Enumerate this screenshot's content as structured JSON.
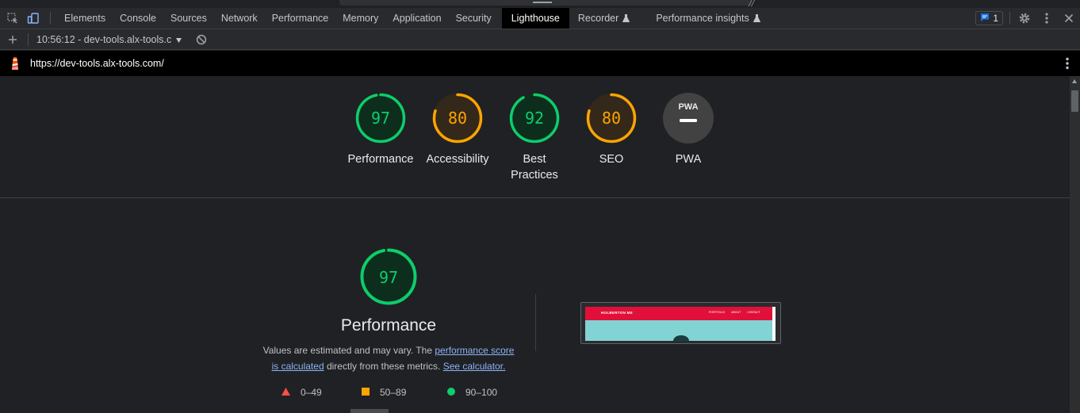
{
  "toolbar": {
    "tabs": [
      {
        "label": "Elements"
      },
      {
        "label": "Console"
      },
      {
        "label": "Sources"
      },
      {
        "label": "Network"
      },
      {
        "label": "Performance"
      },
      {
        "label": "Memory"
      },
      {
        "label": "Application"
      },
      {
        "label": "Security"
      },
      {
        "label": "Lighthouse",
        "active": true
      },
      {
        "label": "Recorder",
        "experimental": true
      },
      {
        "label": "Performance insights",
        "experimental": true
      }
    ],
    "issues_count": "1",
    "icons": [
      "inspect-element-icon",
      "device-toolbar-icon",
      "issues-chat-icon",
      "settings-gear-icon",
      "more-vertical-icon",
      "close-icon"
    ]
  },
  "report_bar": {
    "report_label": "10:56:12 - dev-tools.alx-tools.c",
    "icons": [
      "add-icon",
      "dropdown-triangle-icon",
      "clear-block-icon"
    ]
  },
  "url_bar": {
    "url": "https://dev-tools.alx-tools.com/",
    "icons": [
      "lighthouse-icon",
      "more-vertical-icon"
    ]
  },
  "gauges": [
    {
      "score": "97",
      "value": 97,
      "label": "Performance",
      "status": "pass"
    },
    {
      "score": "80",
      "value": 80,
      "label": "Accessibility",
      "status": "average"
    },
    {
      "score": "92",
      "value": 92,
      "label": "Best Practices",
      "status": "pass"
    },
    {
      "score": "80",
      "value": 80,
      "label": "SEO",
      "status": "average"
    },
    {
      "score": "",
      "value": null,
      "label": "PWA",
      "badge": "PWA"
    }
  ],
  "performance": {
    "score": "97",
    "value": 97,
    "title": "Performance",
    "desc_prefix": "Values are estimated and may vary. The",
    "desc_link1_a": "performance score",
    "desc_link1_b": "is calculated",
    "desc_middle": "directly from these metrics.",
    "desc_link2": "See calculator.",
    "legend": [
      {
        "shape": "triangle",
        "range": "0–49",
        "color": "#ff4e42"
      },
      {
        "shape": "square",
        "range": "50–89",
        "color": "#ffa400"
      },
      {
        "shape": "circle",
        "range": "90–100",
        "color": "#0cce6b"
      }
    ]
  },
  "screenshot": {
    "brand": "HOLBERTON ME",
    "nav": [
      "PORTFOLIO",
      "ABOUT",
      "CONTACT"
    ]
  },
  "colors": {
    "pass": "#0cce6b",
    "average": "#ffa400",
    "fail": "#ff4e42",
    "link": "#8ab4f8",
    "active_tab_bg": "#000000"
  }
}
